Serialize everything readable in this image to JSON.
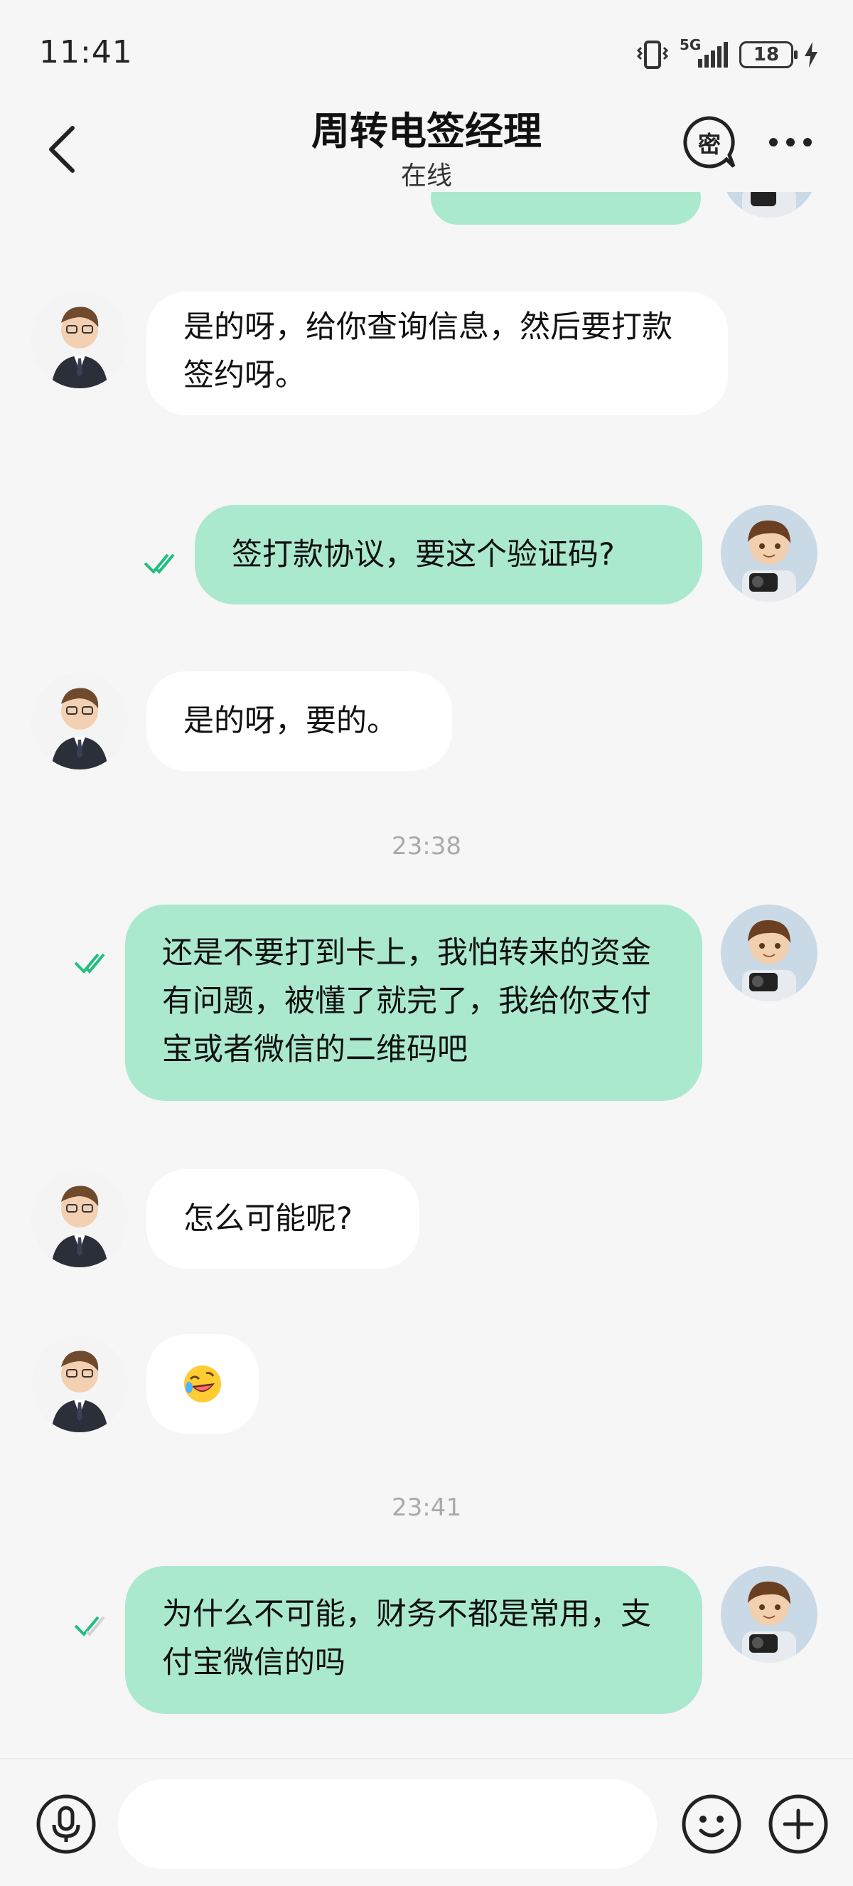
{
  "status": {
    "time": "11:41",
    "network": "5G",
    "battery": "18"
  },
  "header": {
    "title": "周转电签经理",
    "subtitle": "在线",
    "secret_label": "密"
  },
  "messages": [
    {
      "from": "contact",
      "text": "是的呀，给你查询信息，然后要打款签约呀。"
    },
    {
      "from": "me",
      "text": "签打款协议，要这个验证码?",
      "status": "read"
    },
    {
      "from": "contact",
      "text": "是的呀，要的。"
    },
    {
      "from": "me",
      "text": "还是不要打到卡上，我怕转来的资金有问题，被懂了就完了，我给你支付宝或者微信的二维码吧",
      "status": "read"
    },
    {
      "from": "contact",
      "text": "怎么可能呢?"
    },
    {
      "from": "contact",
      "emoji": "rolling-on-floor-laughing"
    },
    {
      "from": "me",
      "text": "为什么不可能，财务不都是常用，支付宝微信的吗",
      "status": "sent"
    }
  ],
  "timestamps": [
    "23:38",
    "23:41"
  ],
  "colors": {
    "outgoing_bubble": "#abe9cf",
    "incoming_bubble": "#ffffff",
    "check": "#1fbf7f",
    "background": "#f6f6f6"
  },
  "input": {
    "placeholder": ""
  }
}
